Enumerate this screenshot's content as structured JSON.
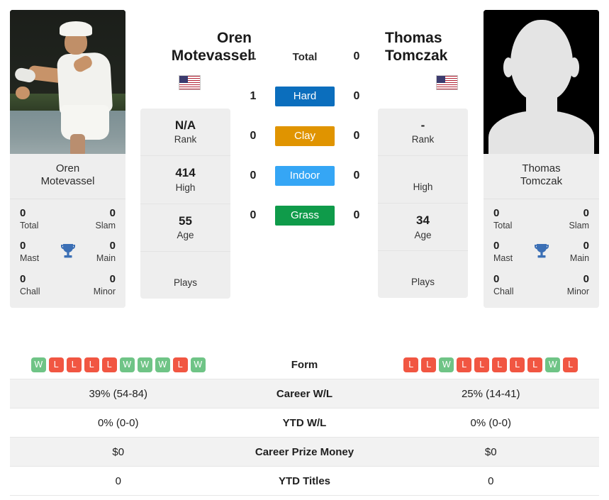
{
  "players": {
    "left": {
      "name": "Oren Motevassel",
      "name_line1": "Oren",
      "name_line2": "Motevassel",
      "flag": "us-flag",
      "photo": "tennis-player-photo",
      "titles": {
        "total_value": "0",
        "total_label": "Total",
        "slam_value": "0",
        "slam_label": "Slam",
        "mast_value": "0",
        "mast_label": "Mast",
        "main_value": "0",
        "main_label": "Main",
        "chall_value": "0",
        "chall_label": "Chall",
        "minor_value": "0",
        "minor_label": "Minor"
      },
      "stats": {
        "rank_value": "N/A",
        "rank_label": "Rank",
        "high_value": "414",
        "high_label": "High",
        "age_value": "55",
        "age_label": "Age",
        "plays_value": "",
        "plays_label": "Plays"
      },
      "h2h": {
        "total": "1",
        "hard": "1",
        "clay": "0",
        "indoor": "0",
        "grass": "0"
      },
      "form": [
        "W",
        "L",
        "L",
        "L",
        "L",
        "W",
        "W",
        "W",
        "L",
        "W"
      ],
      "career_wl": "39% (54-84)",
      "ytd_wl": "0% (0-0)",
      "career_prize_money": "$0",
      "ytd_titles": "0"
    },
    "right": {
      "name": "Thomas Tomczak",
      "name_line1": "Thomas",
      "name_line2": "Tomczak",
      "flag": "us-flag",
      "photo": "placeholder-silhouette",
      "titles": {
        "total_value": "0",
        "total_label": "Total",
        "slam_value": "0",
        "slam_label": "Slam",
        "mast_value": "0",
        "mast_label": "Mast",
        "main_value": "0",
        "main_label": "Main",
        "chall_value": "0",
        "chall_label": "Chall",
        "minor_value": "0",
        "minor_label": "Minor"
      },
      "stats": {
        "rank_value": "-",
        "rank_label": "Rank",
        "high_value": "",
        "high_label": "High",
        "age_value": "34",
        "age_label": "Age",
        "plays_value": "",
        "plays_label": "Plays"
      },
      "h2h": {
        "total": "0",
        "hard": "0",
        "clay": "0",
        "indoor": "0",
        "grass": "0"
      },
      "form": [
        "L",
        "L",
        "W",
        "L",
        "L",
        "L",
        "L",
        "L",
        "W",
        "L"
      ],
      "career_wl": "25% (14-41)",
      "ytd_wl": "0% (0-0)",
      "career_prize_money": "$0",
      "ytd_titles": "0"
    }
  },
  "h2h_rows": [
    {
      "key": "total",
      "label": "Total",
      "badge": false,
      "color": ""
    },
    {
      "key": "hard",
      "label": "Hard",
      "badge": true,
      "color": "#0b6ebd"
    },
    {
      "key": "clay",
      "label": "Clay",
      "badge": true,
      "color": "#e09400"
    },
    {
      "key": "indoor",
      "label": "Indoor",
      "badge": true,
      "color": "#35a6f5"
    },
    {
      "key": "grass",
      "label": "Grass",
      "badge": true,
      "color": "#0f9b4a"
    }
  ],
  "comparison_rows": [
    {
      "label": "Form",
      "type": "form"
    },
    {
      "label": "Career W/L",
      "type": "text",
      "field": "career_wl"
    },
    {
      "label": "YTD W/L",
      "type": "text",
      "field": "ytd_wl"
    },
    {
      "label": "Career Prize Money",
      "type": "text",
      "field": "career_prize_money"
    },
    {
      "label": "YTD Titles",
      "type": "text",
      "field": "ytd_titles"
    }
  ],
  "colors": {
    "win_badge": "#6fc486",
    "loss_badge": "#f15642",
    "trophy": "#3b6fb5",
    "card_bg": "#eeeeee",
    "row_shaded": "#f2f2f2"
  },
  "icons": {
    "trophy": "trophy-icon",
    "flag": "us-flag-icon"
  }
}
